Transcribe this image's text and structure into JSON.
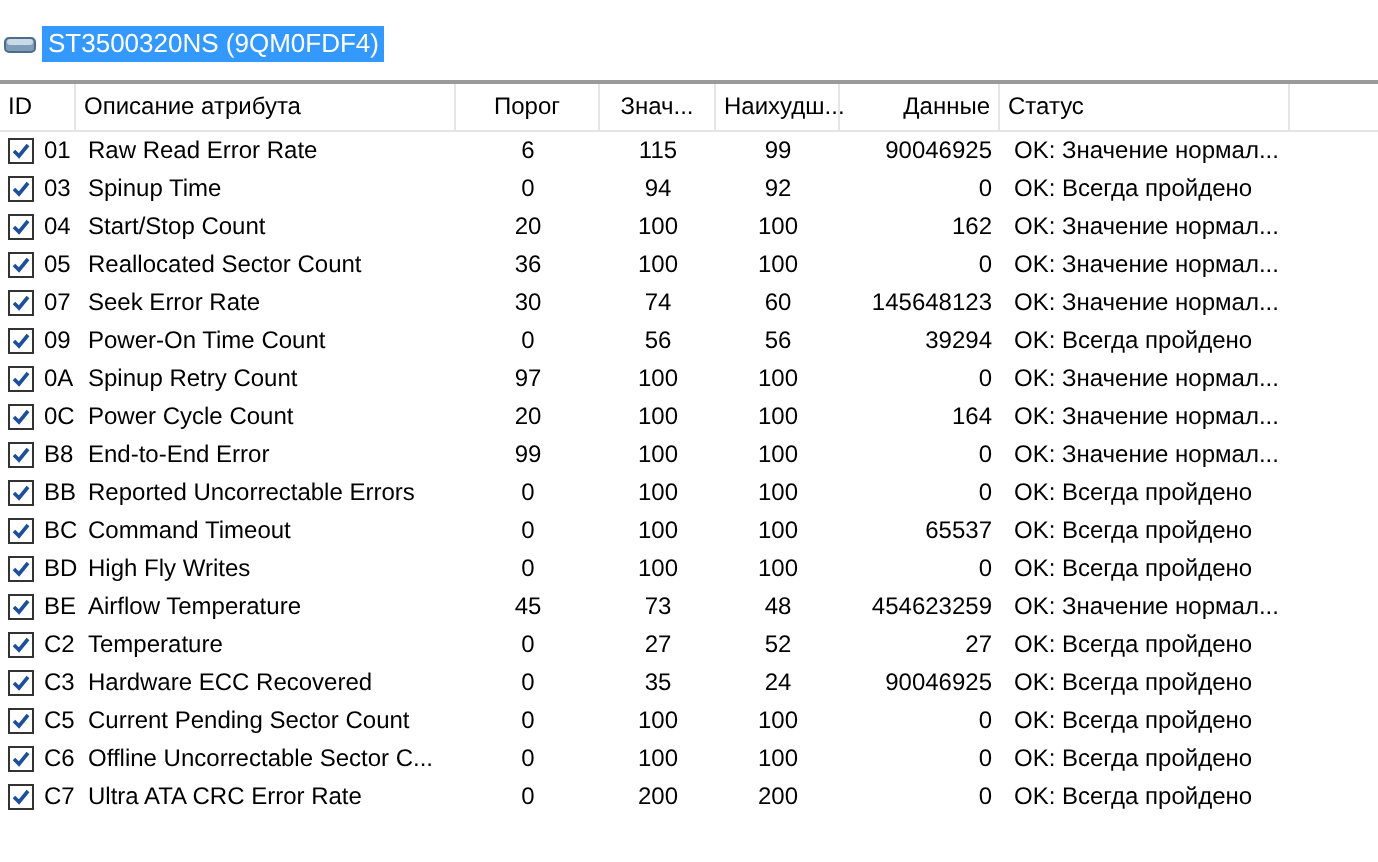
{
  "drive": {
    "title": "ST3500320NS (9QM0FDF4)",
    "selected": true
  },
  "table": {
    "columns": [
      "ID",
      "Описание атрибута",
      "Порог",
      "Знач...",
      "Наихудш...",
      "Данные",
      "Статус"
    ],
    "rows": [
      {
        "checked": true,
        "id": "01",
        "name": "Raw Read Error Rate",
        "threshold": "6",
        "value": "115",
        "worst": "99",
        "data": "90046925",
        "status": "OK: Значение нормал..."
      },
      {
        "checked": true,
        "id": "03",
        "name": "Spinup Time",
        "threshold": "0",
        "value": "94",
        "worst": "92",
        "data": "0",
        "status": "OK: Всегда пройдено"
      },
      {
        "checked": true,
        "id": "04",
        "name": "Start/Stop Count",
        "threshold": "20",
        "value": "100",
        "worst": "100",
        "data": "162",
        "status": "OK: Значение нормал..."
      },
      {
        "checked": true,
        "id": "05",
        "name": "Reallocated Sector Count",
        "threshold": "36",
        "value": "100",
        "worst": "100",
        "data": "0",
        "status": "OK: Значение нормал..."
      },
      {
        "checked": true,
        "id": "07",
        "name": "Seek Error Rate",
        "threshold": "30",
        "value": "74",
        "worst": "60",
        "data": "145648123",
        "status": "OK: Значение нормал..."
      },
      {
        "checked": true,
        "id": "09",
        "name": "Power-On Time Count",
        "threshold": "0",
        "value": "56",
        "worst": "56",
        "data": "39294",
        "status": "OK: Всегда пройдено"
      },
      {
        "checked": true,
        "id": "0A",
        "name": "Spinup Retry Count",
        "threshold": "97",
        "value": "100",
        "worst": "100",
        "data": "0",
        "status": "OK: Значение нормал..."
      },
      {
        "checked": true,
        "id": "0C",
        "name": "Power Cycle Count",
        "threshold": "20",
        "value": "100",
        "worst": "100",
        "data": "164",
        "status": "OK: Значение нормал..."
      },
      {
        "checked": true,
        "id": "B8",
        "name": "End-to-End Error",
        "threshold": "99",
        "value": "100",
        "worst": "100",
        "data": "0",
        "status": "OK: Значение нормал..."
      },
      {
        "checked": true,
        "id": "BB",
        "name": "Reported Uncorrectable Errors",
        "threshold": "0",
        "value": "100",
        "worst": "100",
        "data": "0",
        "status": "OK: Всегда пройдено"
      },
      {
        "checked": true,
        "id": "BC",
        "name": "Command Timeout",
        "threshold": "0",
        "value": "100",
        "worst": "100",
        "data": "65537",
        "status": "OK: Всегда пройдено"
      },
      {
        "checked": true,
        "id": "BD",
        "name": "High Fly Writes",
        "threshold": "0",
        "value": "100",
        "worst": "100",
        "data": "0",
        "status": "OK: Всегда пройдено"
      },
      {
        "checked": true,
        "id": "BE",
        "name": "Airflow Temperature",
        "threshold": "45",
        "value": "73",
        "worst": "48",
        "data": "454623259",
        "status": "OK: Значение нормал..."
      },
      {
        "checked": true,
        "id": "C2",
        "name": "Temperature",
        "threshold": "0",
        "value": "27",
        "worst": "52",
        "data": "27",
        "status": "OK: Всегда пройдено"
      },
      {
        "checked": true,
        "id": "C3",
        "name": "Hardware ECC Recovered",
        "threshold": "0",
        "value": "35",
        "worst": "24",
        "data": "90046925",
        "status": "OK: Всегда пройдено"
      },
      {
        "checked": true,
        "id": "C5",
        "name": "Current Pending Sector Count",
        "threshold": "0",
        "value": "100",
        "worst": "100",
        "data": "0",
        "status": "OK: Всегда пройдено"
      },
      {
        "checked": true,
        "id": "C6",
        "name": "Offline Uncorrectable Sector C...",
        "threshold": "0",
        "value": "100",
        "worst": "100",
        "data": "0",
        "status": "OK: Всегда пройдено"
      },
      {
        "checked": true,
        "id": "C7",
        "name": "Ultra ATA CRC Error Rate",
        "threshold": "0",
        "value": "200",
        "worst": "200",
        "data": "0",
        "status": "OK: Всегда пройдено"
      }
    ]
  }
}
